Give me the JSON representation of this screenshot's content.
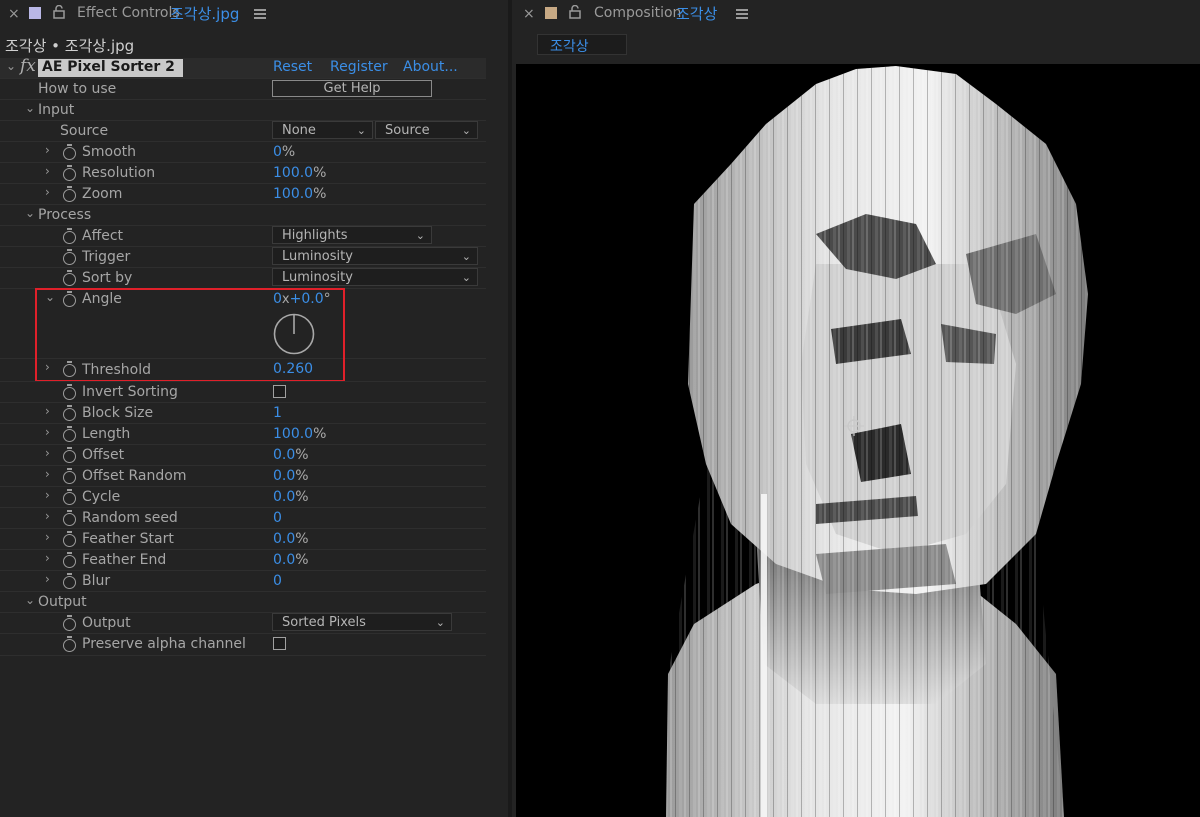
{
  "effect_panel": {
    "close_glyph": "×",
    "tab_prefix": "Effect Controls",
    "tab_file": "조각상.jpg",
    "breadcrumb": "조각상 • 조각상.jpg",
    "effect": {
      "fx_glyph": "fx",
      "name": "AE Pixel Sorter 2",
      "reset": "Reset",
      "register": "Register",
      "about": "About..."
    },
    "how_to_use": {
      "label": "How to use",
      "button": "Get Help"
    },
    "input": {
      "group": "Input",
      "source_label": "Source",
      "source_layer": "None",
      "source_mode": "Source",
      "smooth": {
        "label": "Smooth",
        "value": "0",
        "unit": "%"
      },
      "resolution": {
        "label": "Resolution",
        "value": "100.0",
        "unit": "%"
      },
      "zoom": {
        "label": "Zoom",
        "value": "100.0",
        "unit": "%"
      }
    },
    "process": {
      "group": "Process",
      "affect": {
        "label": "Affect",
        "value": "Highlights"
      },
      "trigger": {
        "label": "Trigger",
        "value": "Luminosity"
      },
      "sort_by": {
        "label": "Sort by",
        "value": "Luminosity"
      },
      "angle": {
        "label": "Angle",
        "revolutions": "0",
        "x": "x",
        "degrees": "+0.0",
        "deg_symbol": "°"
      },
      "threshold": {
        "label": "Threshold",
        "value": "0.260"
      },
      "invert_sorting": {
        "label": "Invert Sorting",
        "checked": false
      },
      "block_size": {
        "label": "Block Size",
        "value": "1"
      },
      "length": {
        "label": "Length",
        "value": "100.0",
        "unit": "%"
      },
      "offset": {
        "label": "Offset",
        "value": "0.0",
        "unit": "%"
      },
      "offset_random": {
        "label": "Offset Random",
        "value": "0.0",
        "unit": "%"
      },
      "cycle": {
        "label": "Cycle",
        "value": "0.0",
        "unit": "%"
      },
      "random_seed": {
        "label": "Random seed",
        "value": "0"
      },
      "feather_start": {
        "label": "Feather Start",
        "value": "0.0",
        "unit": "%"
      },
      "feather_end": {
        "label": "Feather End",
        "value": "0.0",
        "unit": "%"
      },
      "blur": {
        "label": "Blur",
        "value": "0"
      }
    },
    "output": {
      "group": "Output",
      "output": {
        "label": "Output",
        "value": "Sorted Pixels"
      },
      "preserve_alpha": {
        "label": "Preserve alpha channel",
        "checked": false
      }
    }
  },
  "composition_panel": {
    "close_glyph": "×",
    "tab_prefix": "Composition",
    "tab_name": "조각상",
    "comp_tab": "조각상"
  },
  "colors": {
    "accent_blue": "#3b8ee6",
    "highlight_box": "#e0202a",
    "panel_bg": "#232323"
  }
}
